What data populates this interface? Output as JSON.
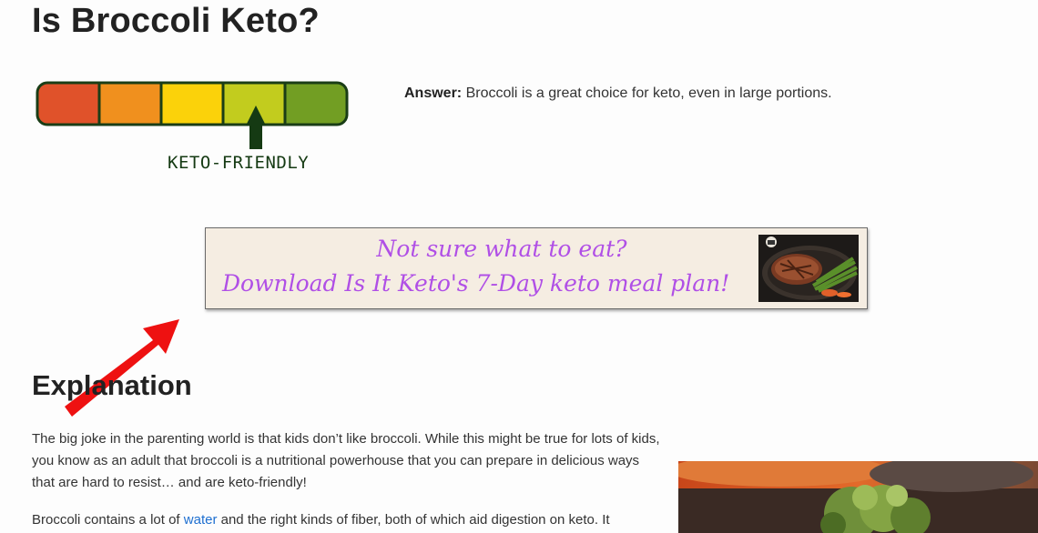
{
  "article": {
    "title": "Is Broccoli Keto?",
    "meter": {
      "label": "KETO-FRIENDLY",
      "colors": [
        "#e0522a",
        "#f0901e",
        "#fbd20a",
        "#c2cc1e",
        "#729e23"
      ],
      "selected_segment": 4,
      "segment_count": 5
    },
    "answer": {
      "label": "Answer:",
      "text": " Broccoli is a great choice for keto, even in large portions."
    },
    "banner": {
      "line1": "Not sure what to eat?",
      "line2": "Download Is It Keto's 7-Day keto meal plan!",
      "photo_icon": "steak-asparagus-photo"
    },
    "explanation": {
      "heading": "Explanation",
      "paragraph1": "The big joke in the parenting world is that kids don’t like broccoli. While this might be true for lots of kids, you know as an adult that broccoli is a nutritional powerhouse that you can prepare in delicious ways that are hard to resist… and are keto-friendly!",
      "paragraph2_before": "Broccoli contains a lot of ",
      "paragraph2_link": "water",
      "paragraph2_after": " and the right kinds of fiber, both of which aid digestion on keto. It"
    }
  },
  "colors": {
    "text": "#333333",
    "link": "#1e6fd0",
    "banner_text": "#b04fe6",
    "banner_bg": "#f5ede2",
    "arrow": "#ee1111"
  }
}
